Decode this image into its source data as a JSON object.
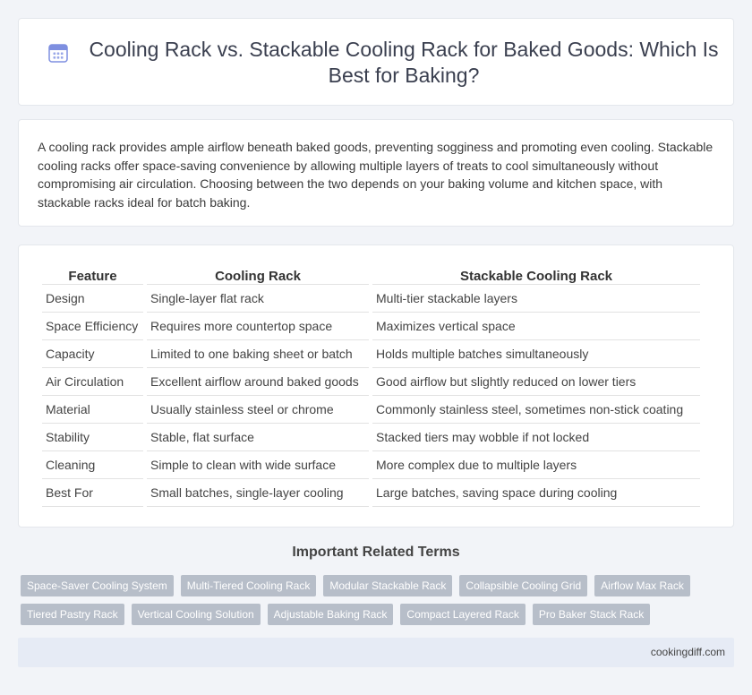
{
  "header": {
    "title": "Cooling Rack vs. Stackable Cooling Rack for Baked Goods: Which Is Best for Baking?",
    "icon": "calendar-icon"
  },
  "intro": {
    "text": "A cooling rack provides ample airflow beneath baked goods, preventing sogginess and promoting even cooling. Stackable cooling racks offer space-saving convenience by allowing multiple layers of treats to cool simultaneously without compromising air circulation. Choosing between the two depends on your baking volume and kitchen space, with stackable racks ideal for batch baking."
  },
  "table": {
    "headers": [
      "Feature",
      "Cooling Rack",
      "Stackable Cooling Rack"
    ],
    "rows": [
      [
        "Design",
        "Single-layer flat rack",
        "Multi-tier stackable layers"
      ],
      [
        "Space Efficiency",
        "Requires more countertop space",
        "Maximizes vertical space"
      ],
      [
        "Capacity",
        "Limited to one baking sheet or batch",
        "Holds multiple batches simultaneously"
      ],
      [
        "Air Circulation",
        "Excellent airflow around baked goods",
        "Good airflow but slightly reduced on lower tiers"
      ],
      [
        "Material",
        "Usually stainless steel or chrome",
        "Commonly stainless steel, sometimes non-stick coating"
      ],
      [
        "Stability",
        "Stable, flat surface",
        "Stacked tiers may wobble if not locked"
      ],
      [
        "Cleaning",
        "Simple to clean with wide surface",
        "More complex due to multiple layers"
      ],
      [
        "Best For",
        "Small batches, single-layer cooling",
        "Large batches, saving space during cooling"
      ]
    ]
  },
  "related": {
    "title": "Important Related Terms",
    "tags": [
      "Space-Saver Cooling System",
      "Multi-Tiered Cooling Rack",
      "Modular Stackable Rack",
      "Collapsible Cooling Grid",
      "Airflow Max Rack",
      "Tiered Pastry Rack",
      "Vertical Cooling Solution",
      "Adjustable Baking Rack",
      "Compact Layered Rack",
      "Pro Baker Stack Rack"
    ]
  },
  "footer": {
    "site": "cookingdiff.com"
  },
  "colors": {
    "background": "#f2f4f8",
    "tag": "#b7bec9",
    "footer": "#e6ebf5",
    "icon": "#6b7fd6"
  }
}
